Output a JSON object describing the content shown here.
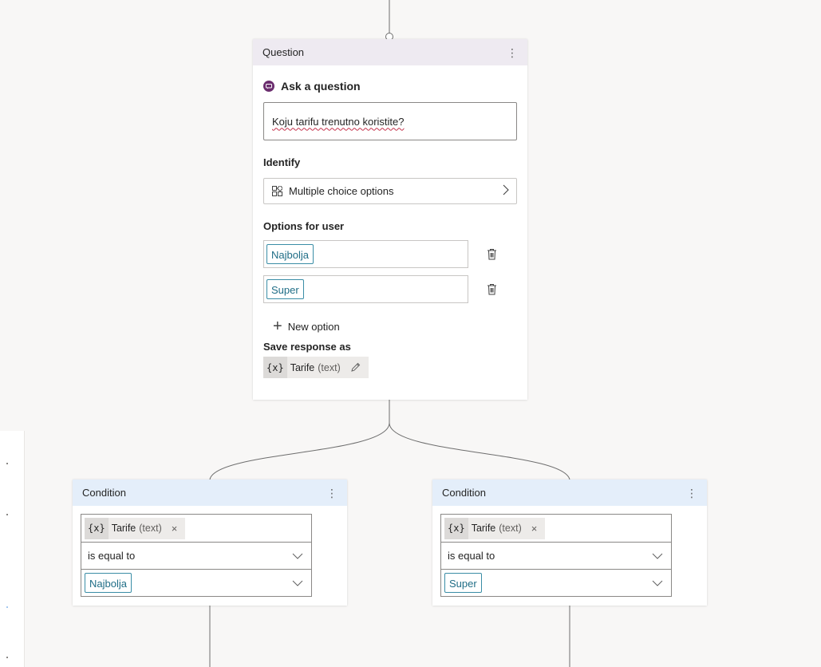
{
  "question_node": {
    "header": "Question",
    "menu_glyph": "⋮",
    "ask_label": "Ask a question",
    "question_text": "Koju tarifu trenutno koristite?",
    "identify_label": "Identify",
    "identify_value": "Multiple choice options",
    "options_label": "Options for user",
    "options": [
      "Najbolja",
      "Super"
    ],
    "new_option_label": "New option",
    "new_option_glyph": "+",
    "save_response_label": "Save response as",
    "variable": {
      "icon_text": "{x}",
      "name": "Tarife",
      "type": "(text)"
    }
  },
  "conditions": [
    {
      "header": "Condition",
      "menu_glyph": "⋮",
      "variable": {
        "icon_text": "{x}",
        "name": "Tarife",
        "type": "(text)",
        "remove_glyph": "×"
      },
      "operator": "is equal to",
      "value": "Najbolja"
    },
    {
      "header": "Condition",
      "menu_glyph": "⋮",
      "variable": {
        "icon_text": "{x}",
        "name": "Tarife",
        "type": "(text)",
        "remove_glyph": "×"
      },
      "operator": "is equal to",
      "value": "Super"
    }
  ],
  "colors": {
    "question_header": "#eeeaf1",
    "condition_header": "#e4eefa",
    "tag_border": "#3a8da6",
    "ask_icon": "#6b2d6e"
  },
  "icons": {
    "ask": "chat-bubble-icon",
    "identify": "grid-icon",
    "identify_open": "chevron-right-icon",
    "delete": "trash-icon",
    "add": "plus-icon",
    "edit": "pencil-icon",
    "dropdown": "chevron-down-icon",
    "remove": "close-icon",
    "menu": "more-vertical-icon"
  }
}
